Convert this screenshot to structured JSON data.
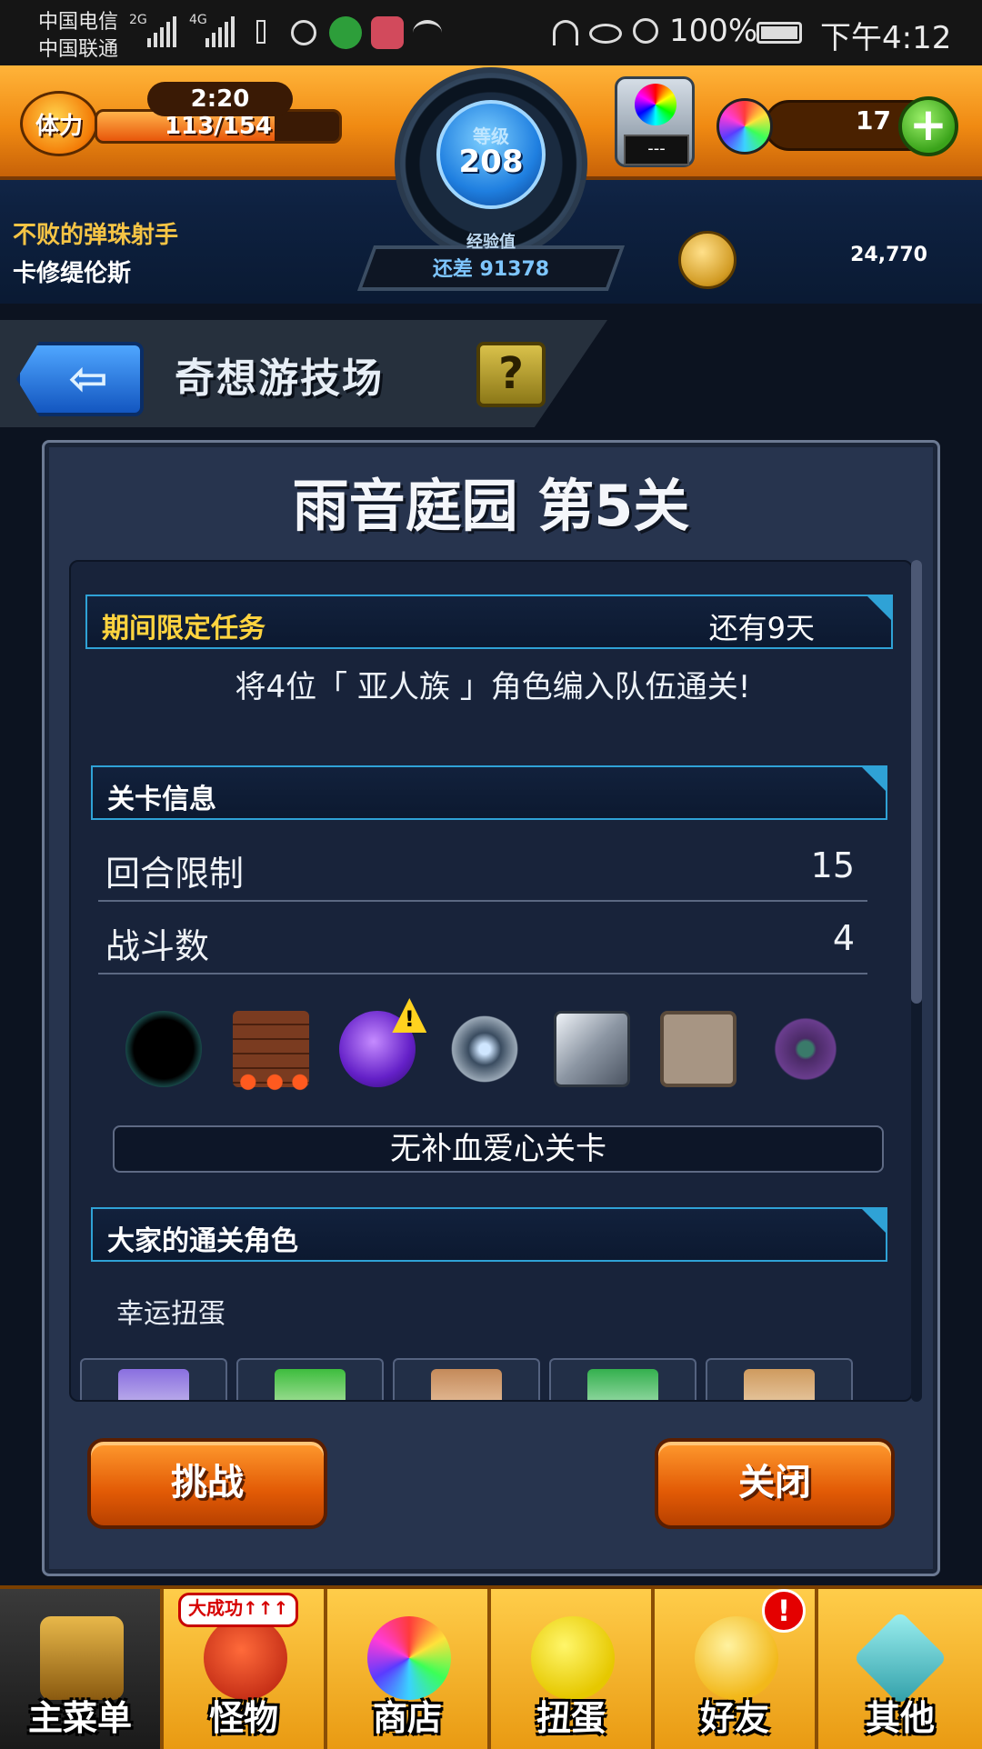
{
  "status_bar": {
    "carrier_1": "中国电信",
    "carrier_2": "中国联通",
    "net_1": "2G",
    "net_2": "4G",
    "battery": "100%",
    "time": "下午4:12"
  },
  "hud": {
    "stamina_label": "体力",
    "stamina_timer": "2:20",
    "stamina_value": "113/154",
    "stamina_fraction": 0.734,
    "level_label": "等级",
    "level": "208",
    "exp_label": "经验值",
    "exp_remaining": "还差 91378",
    "gem_display": "---",
    "orb_count": "17",
    "plus_symbol": "+",
    "player_title": "不败的弹珠射手",
    "player_name": "卡修缇伦斯",
    "coins": "24,770"
  },
  "page": {
    "title": "奇想游技场",
    "help": "?"
  },
  "stage": {
    "title": "雨音庭园 第5关",
    "limited_mission_header": "期间限定任务",
    "time_left": "还有9天",
    "mission_text": "将4位「 亚人族 」角色编入队伍通关!",
    "info_header": "关卡信息",
    "rows": [
      {
        "label": "回合限制",
        "value": "15"
      },
      {
        "label": "战斗数",
        "value": "4"
      }
    ],
    "gimmick_icons": [
      "black-hole-icon",
      "brick-wall-damage-icon",
      "purple-orb-warning-icon",
      "spike-mine-icon",
      "metal-block-icon",
      "damage-panel-icon",
      "warp-gate-icon"
    ],
    "warning_symbol": "!",
    "no_heal_label": "无补血爱心关卡",
    "clear_header": "大家的通关角色",
    "lucky_label": "幸运扭蛋"
  },
  "buttons": {
    "challenge": "挑战",
    "close": "关闭"
  },
  "bottom_nav": [
    {
      "label": "主菜单"
    },
    {
      "label": "怪物",
      "badge": "大成功↑↑↑"
    },
    {
      "label": "商店"
    },
    {
      "label": "扭蛋"
    },
    {
      "label": "好友",
      "alert": "!"
    },
    {
      "label": "其他"
    }
  ],
  "colors": {
    "accent_orange": "#f08a12",
    "section_border": "#2fa2d6",
    "gold_text": "#ffd43f",
    "panel_bg": "#27344e"
  }
}
